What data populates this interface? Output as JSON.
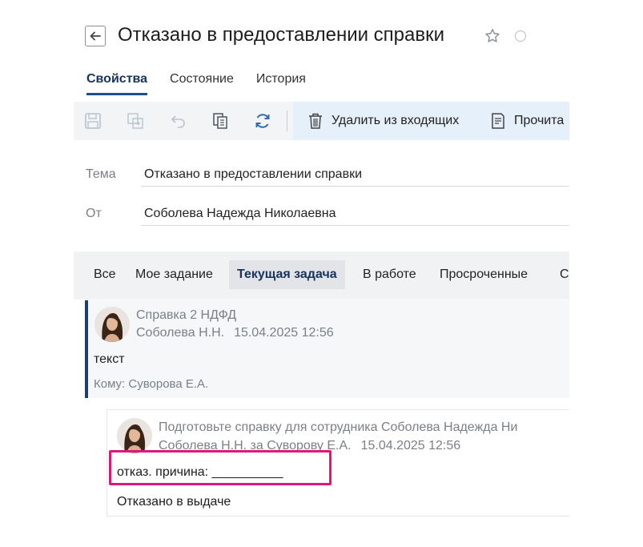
{
  "header": {
    "title": "Отказано в предоставлении справки",
    "back_icon": "arrow-left-icon",
    "star_icon": "star-icon",
    "status_icon": "circle-icon"
  },
  "tabs": [
    {
      "label": "Свойства",
      "active": true
    },
    {
      "label": "Состояние",
      "active": false
    },
    {
      "label": "История",
      "active": false
    }
  ],
  "toolbar": {
    "icons": [
      "save-icon",
      "forward-icon",
      "undo-icon",
      "copy-icon",
      "refresh-icon"
    ],
    "delete_label": "Удалить из входящих",
    "read_label": "Прочита"
  },
  "fields": {
    "subject_label": "Тема",
    "subject_value": "Отказано в предоставлении справки",
    "from_label": "От",
    "from_value": "Соболева Надежда Николаевна"
  },
  "filters": [
    {
      "label": "Все",
      "active": false
    },
    {
      "label": "Мое задание",
      "active": false
    },
    {
      "label": "Текущая задача",
      "active": true
    },
    {
      "label": "В работе",
      "active": false
    },
    {
      "label": "Просроченные",
      "active": false
    },
    {
      "label": "С",
      "active": false
    }
  ],
  "posts": [
    {
      "title": "Справка 2 НДФД",
      "author": "Соболева Н.Н.",
      "date": "15.04.2025 12:56",
      "text": "текст",
      "to": "Кому: Суворова Е.А."
    },
    {
      "title": "Подготовьте справку для сотрудника Соболева Надежда Ни",
      "author": "Соболева Н.Н. за Суворову Е.А.",
      "date": "15.04.2025 12:56",
      "text": "отказ. причина: __________",
      "result": "Отказано в выдаче"
    }
  ],
  "colors": {
    "accent": "#1f4e8c",
    "highlight": "#e0177a",
    "toolbar_bg": "#f3f4f6",
    "toolbar_active_bg": "#e6f0fb"
  }
}
